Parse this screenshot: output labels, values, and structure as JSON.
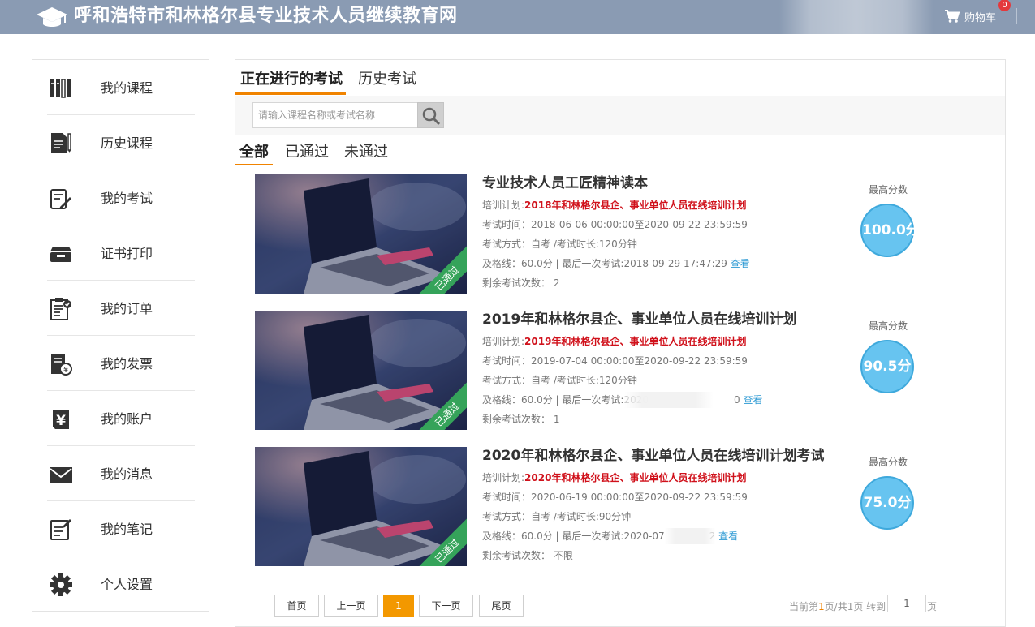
{
  "header": {
    "site_title": "呼和浩特市和林格尔县专业技术人员继续教育网",
    "cart_label": "购物车",
    "cart_count": "0"
  },
  "sidebar": {
    "items": [
      {
        "label": "我的课程",
        "icon": "books-icon"
      },
      {
        "label": "历史课程",
        "icon": "document-pen-icon"
      },
      {
        "label": "我的考试",
        "icon": "exam-edit-icon"
      },
      {
        "label": "证书打印",
        "icon": "printer-tray-icon"
      },
      {
        "label": "我的订单",
        "icon": "clipboard-check-icon"
      },
      {
        "label": "我的发票",
        "icon": "invoice-yen-icon"
      },
      {
        "label": "我的账户",
        "icon": "account-yen-icon"
      },
      {
        "label": "我的消息",
        "icon": "envelope-icon"
      },
      {
        "label": "我的笔记",
        "icon": "notepad-edit-icon"
      },
      {
        "label": "个人设置",
        "icon": "gear-icon"
      }
    ]
  },
  "tabs": [
    "正在进行的考试",
    "历史考试"
  ],
  "search": {
    "placeholder": "请输入课程名称或考试名称"
  },
  "filters": [
    "全部",
    "已通过",
    "未通过"
  ],
  "labels": {
    "plan": "培训计划:",
    "time": "考试时间：",
    "mode": "考试方式：",
    "pass": "及格线：",
    "remaining": "剩余考试次数：",
    "best_score": "最高分数",
    "view": "查看",
    "passed_tag": "已通过"
  },
  "exams": [
    {
      "title": "专业技术人员工匠精神读本",
      "plan": "2018年和林格尔县企、事业单位人员在线培训计划",
      "time": "2018-06-06 00:00:00至2020-09-22 23:59:59",
      "mode": "自考 /考试时长:120分钟",
      "pass": "60.0分 | 最后一次考试:2018-09-29 17:47:29",
      "remaining": "2",
      "score": "100.0分"
    },
    {
      "title": "2019年和林格尔县企、事业单位人员在线培训计划",
      "plan": "2019年和林格尔县企、事业单位人员在线培训计划",
      "time": "2019-07-04 00:00:00至2020-09-22 23:59:59",
      "mode": "自考 /考试时长:120分钟",
      "pass": "60.0分 | 最后一次考试:2020",
      "pass_tail": "0",
      "remaining": "1",
      "score": "90.5分"
    },
    {
      "title": "2020年和林格尔县企、事业单位人员在线培训计划考试",
      "plan": "2020年和林格尔县企、事业单位人员在线培训计划",
      "time": "2020-06-19 00:00:00至2020-09-22 23:59:59",
      "mode": "自考 /考试时长:90分钟",
      "pass": "60.0分 | 最后一次考试:2020-07",
      "pass_tail": "2",
      "remaining": "不限",
      "score": "75.0分"
    }
  ],
  "pagination": {
    "first": "首页",
    "prev": "上一页",
    "current": "1",
    "next": "下一页",
    "last": "尾页",
    "info_prefix": "当前第",
    "info_page": "1",
    "info_mid": "页/共",
    "info_total": "1",
    "info_goto": "页 转到",
    "goto_value": "1",
    "unit": "页"
  },
  "colors": {
    "header_bg": "#8a9bb3",
    "accent_orange": "#f08300",
    "plan_red": "#d0111b",
    "link_blue": "#2f9bd4",
    "score_blue": "#67c4f0",
    "passed_green": "#35a35a"
  }
}
